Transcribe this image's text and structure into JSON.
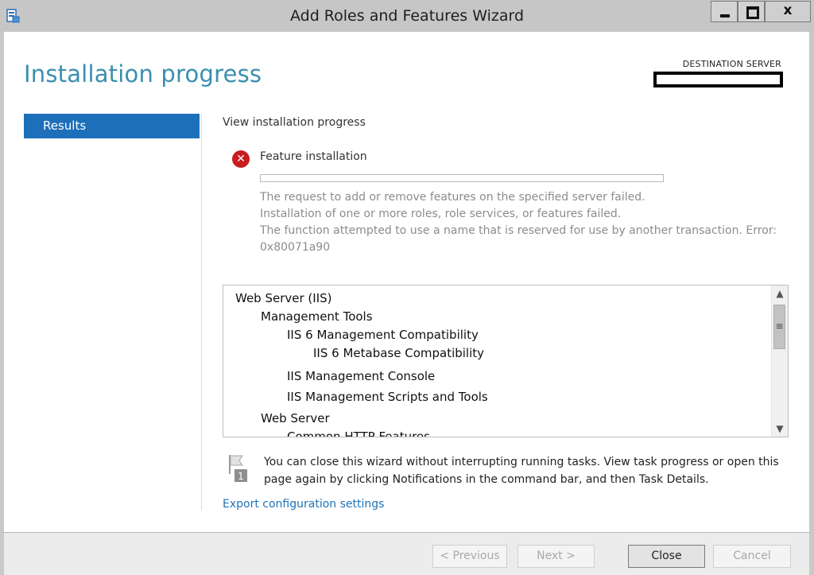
{
  "window": {
    "title": "Add Roles and Features Wizard",
    "close_glyph": "x"
  },
  "page": {
    "title": "Installation progress",
    "destination_label": "DESTINATION SERVER"
  },
  "nav": {
    "items": [
      {
        "label": "Results",
        "selected": true
      }
    ]
  },
  "main": {
    "section_title": "View installation progress",
    "feature": {
      "status_icon": "error-icon",
      "label": "Feature installation",
      "progress_fraction": 0
    },
    "messages": [
      "The request to add or remove features on the specified server failed.",
      "Installation of one or more roles, role services, or features failed.",
      "The function attempted to use a name that is reserved for use by another transaction. Error:",
      "0x80071a90"
    ],
    "tree": [
      {
        "label": "Web Server (IIS)",
        "level": 0
      },
      {
        "label": "Management Tools",
        "level": 1
      },
      {
        "label": "IIS 6 Management Compatibility",
        "level": 2
      },
      {
        "label": "IIS 6 Metabase Compatibility",
        "level": 3
      },
      {
        "label": "IIS Management Console",
        "level": 2
      },
      {
        "label": "IIS Management Scripts and Tools",
        "level": 2
      },
      {
        "label": "Web Server",
        "level": 1
      },
      {
        "label": "Common HTTP Features",
        "level": 2
      }
    ],
    "info_text": "You can close this wizard without interrupting running tasks. View task progress or open this page again by clicking Notifications in the command bar, and then Task Details.",
    "info_icon": "flag-notification-icon",
    "info_badge": "1",
    "export_link": "Export configuration settings"
  },
  "footer": {
    "previous": "< Previous",
    "next": "Next >",
    "close": "Close",
    "cancel": "Cancel"
  },
  "colors": {
    "accent": "#3a8fb0",
    "nav_selected": "#1e6fb9",
    "error": "#c81e1e",
    "link": "#1e73b8"
  }
}
